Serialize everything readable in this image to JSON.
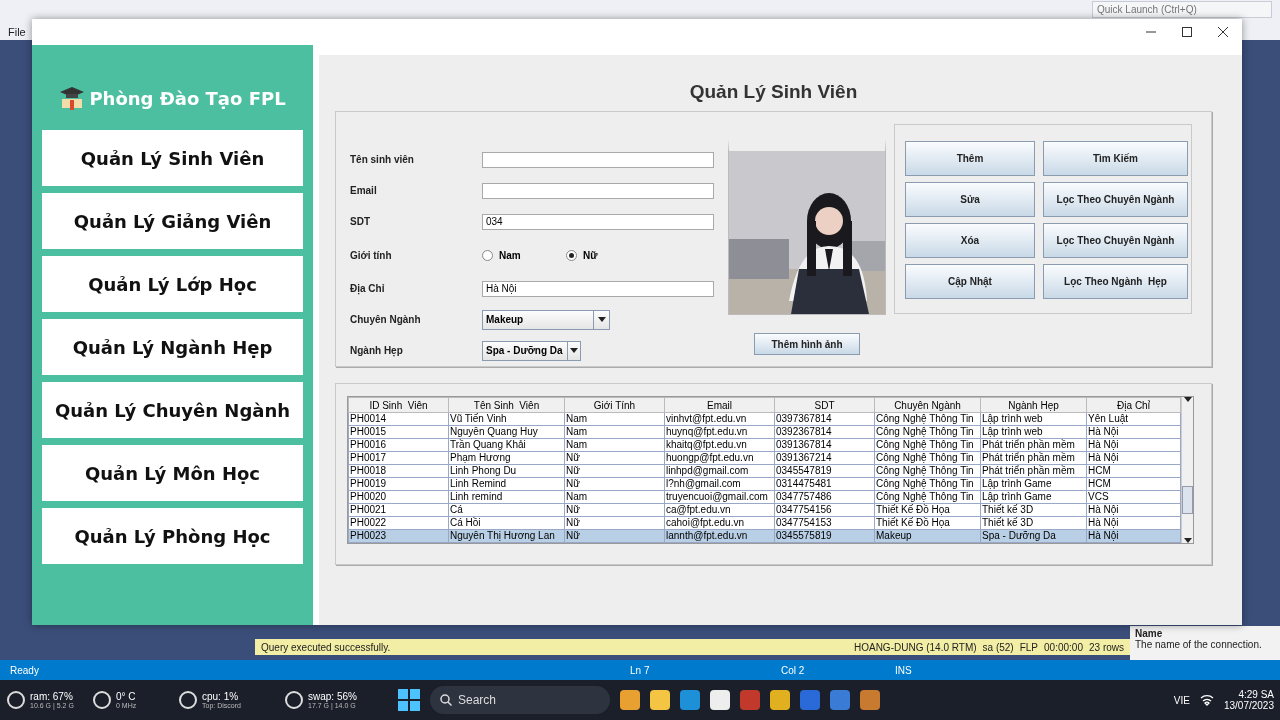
{
  "background_app": {
    "menu": [
      "File"
    ],
    "quick_launch": {
      "placeholder": "Quick Launch (Ctrl+Q)"
    },
    "query_status": "Query executed successfully.",
    "connection_info": [
      "HOANG-DUNG (14.0 RTM)",
      "sa (52)",
      "FLP",
      "00:00:00",
      "23 rows"
    ],
    "property_help": {
      "title": "Name",
      "text": "The name of the connection."
    },
    "status_bar": {
      "state": "Ready",
      "line": "Ln 7",
      "column": "Col 2",
      "mode": "INS"
    }
  },
  "app": {
    "sidebar": {
      "title": "Phòng Đào Tạo FPL",
      "items": [
        "Quản Lý Sinh Viên",
        "Quản Lý Giảng Viên",
        "Quản Lý Lớp Học",
        "Quản Lý Ngành Hẹp",
        "Quản Lý Chuyên Ngành",
        "Quản Lý Môn Học",
        "Quản Lý Phòng Học"
      ]
    },
    "page_title": "Quản Lý Sinh Viên",
    "form": {
      "fields": [
        {
          "kind": "text",
          "label": "Tên sinh viên"
        },
        {
          "kind": "text",
          "label": "Email"
        },
        {
          "kind": "text",
          "label": "SDT",
          "value": "034"
        },
        {
          "kind": "radio",
          "label": "Giới tính",
          "options": [
            {
              "label": "Nam",
              "selected": false
            },
            {
              "label": "Nữ",
              "selected": true
            }
          ]
        },
        {
          "kind": "text",
          "label": "Địa Chỉ",
          "value": "Hà Nội"
        },
        {
          "kind": "select",
          "label": "Chuyên Ngành",
          "value": "Makeup"
        },
        {
          "kind": "select",
          "label": "Ngành Hẹp",
          "value": "Spa - Dưỡng Da"
        }
      ],
      "photo_button": "Thêm hình ảnh",
      "actions": [
        "Thêm",
        "Tìm Kiếm",
        "Sửa",
        "Lọc Theo Chuyên Ngành",
        "Xóa",
        "Lọc Theo Chuyên Ngành",
        "Cập Nhật",
        "Lọc Theo Ngành  Hẹp"
      ]
    },
    "table": {
      "columns": [
        "ID Sinh  Viên",
        "Tên Sinh  Viên",
        "Giới Tính",
        "Email",
        "SDT",
        "Chuyên Ngành",
        "Ngành Hẹp",
        "Địa Chỉ"
      ],
      "rows": [
        {
          "selected": false,
          "cells": [
            "PH0014",
            "Vũ Tiến Vinh",
            "Nam",
            "vinhvt@fpt.edu.vn",
            "0397367814",
            "Công Nghệ Thông Tin",
            "Lập trình web",
            "Yên Luật"
          ]
        },
        {
          "selected": false,
          "cells": [
            "PH0015",
            "Nguyễn Quang Huy",
            "Nam",
            "huynq@fpt.edu.vn",
            "0392367814",
            "Công Nghệ Thông Tin",
            "Lập trình web",
            "Hà Nội"
          ]
        },
        {
          "selected": false,
          "cells": [
            "PH0016",
            "Trần Quang Khải",
            "Nam",
            "khaitq@fpt.edu.vn",
            "0391367814",
            "Công Nghệ Thông Tin",
            "Phát triển phần mềm",
            "Hà Nội"
          ]
        },
        {
          "selected": false,
          "cells": [
            "PH0017",
            "Phạm Hương",
            "Nữ",
            "huongp@fpt.edu.vn",
            "0391367214",
            "Công Nghệ Thông Tin",
            "Phát triển phần mềm",
            "Hà Nội"
          ]
        },
        {
          "selected": false,
          "cells": [
            "PH0018",
            "Linh Phong Du",
            "Nữ",
            "linhpd@gmail.com",
            "0345547819",
            "Công Nghệ Thông Tin",
            "Phát triển phần mềm",
            "HCM"
          ]
        },
        {
          "selected": false,
          "cells": [
            "PH0019",
            "Linh Remind",
            "Nữ",
            "l?nh@gmail.com",
            "0314475481",
            "Công Nghệ Thông Tin",
            "Lập trình Game",
            "HCM"
          ]
        },
        {
          "selected": false,
          "cells": [
            "PH0020",
            "Linh remind",
            "Nam",
            "truyencuoi@gmail.com",
            "0347757486",
            "Công Nghệ Thông Tin",
            "Lập trình Game",
            "VCS"
          ]
        },
        {
          "selected": false,
          "cells": [
            "PH0021",
            "Cá",
            "Nữ",
            "ca@fpt.edu.vn",
            "0347754156",
            "Thiết Kế Đồ Họa",
            "Thiết kế 3D",
            "Hà Nội"
          ]
        },
        {
          "selected": false,
          "cells": [
            "PH0022",
            "Cá Hồi",
            "Nữ",
            "cahoi@fpt.edu.vn",
            "0347754153",
            "Thiết Kế Đồ Họa",
            "Thiết kế 3D",
            "Hà Nội"
          ]
        },
        {
          "selected": true,
          "cells": [
            "PH0023",
            "Nguyễn Thị Hương Lan",
            "Nữ",
            "lannth@fpt.edu.vn",
            "0345575819",
            "Makeup",
            "Spa - Dưỡng Da",
            "Hà Nội"
          ]
        }
      ]
    }
  },
  "taskbar": {
    "widgets": [
      {
        "label": "ram: 67%",
        "detail": "10.6 G | 5.2 G"
      },
      {
        "label": "0° C",
        "detail": "0 MHz"
      },
      {
        "label": "cpu: 1%",
        "detail": "Top: Discord"
      },
      {
        "label": "swap: 56%",
        "detail": "17.7 G | 14.0 G"
      }
    ],
    "search": {
      "placeholder": "Search"
    },
    "language": "VIE",
    "time": "4:29 SA",
    "date": "13/07/2023"
  }
}
